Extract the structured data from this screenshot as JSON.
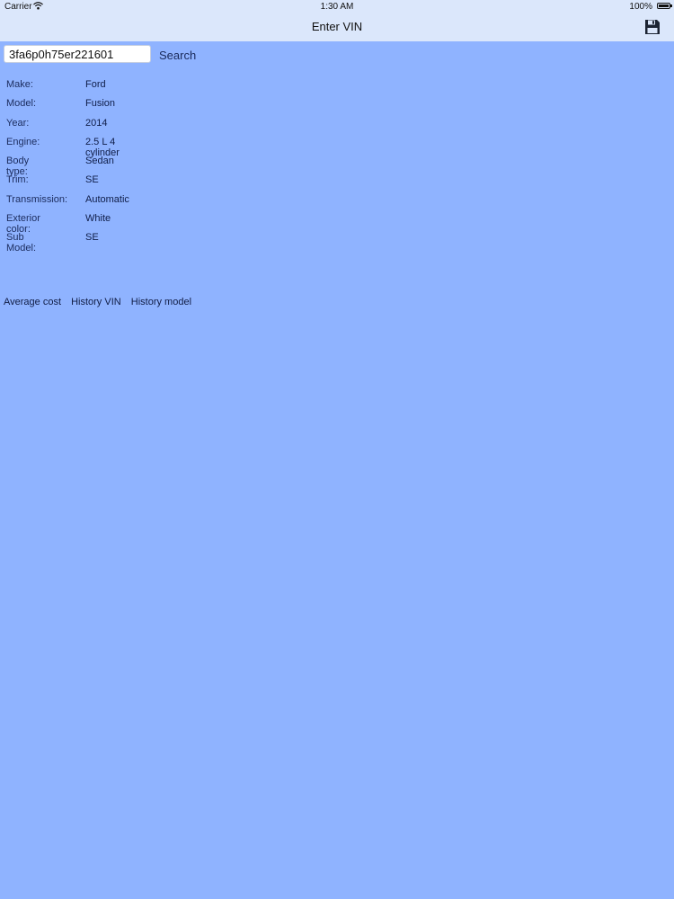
{
  "status_bar": {
    "carrier": "Carrier",
    "time": "1:30 AM",
    "battery": "100%"
  },
  "nav": {
    "title": "Enter VIN",
    "save_icon": "floppy-disk-icon"
  },
  "search": {
    "vin_value": "3fa6p0h75er221601",
    "button_label": "Search"
  },
  "details": [
    {
      "label": "Make:",
      "value": "Ford"
    },
    {
      "label": "Model:",
      "value": "Fusion"
    },
    {
      "label": "Year:",
      "value": "2014"
    },
    {
      "label": "Engine:",
      "value": "2.5 L 4 cylinder"
    },
    {
      "label": "Body type:",
      "value": "Sedan"
    },
    {
      "label": "Trim:",
      "value": "SE"
    },
    {
      "label": "Transmission:",
      "value": "Automatic"
    },
    {
      "label": "Exterior color:",
      "value": "White"
    },
    {
      "label": "Sub Model:",
      "value": "SE"
    }
  ],
  "links": {
    "average_cost": "Average cost",
    "history_vin": "History VIN",
    "history_model": "History model"
  },
  "colors": {
    "background": "#8fb3ff",
    "navbar": "#dbe7fb",
    "text": "#1a2a5a"
  }
}
